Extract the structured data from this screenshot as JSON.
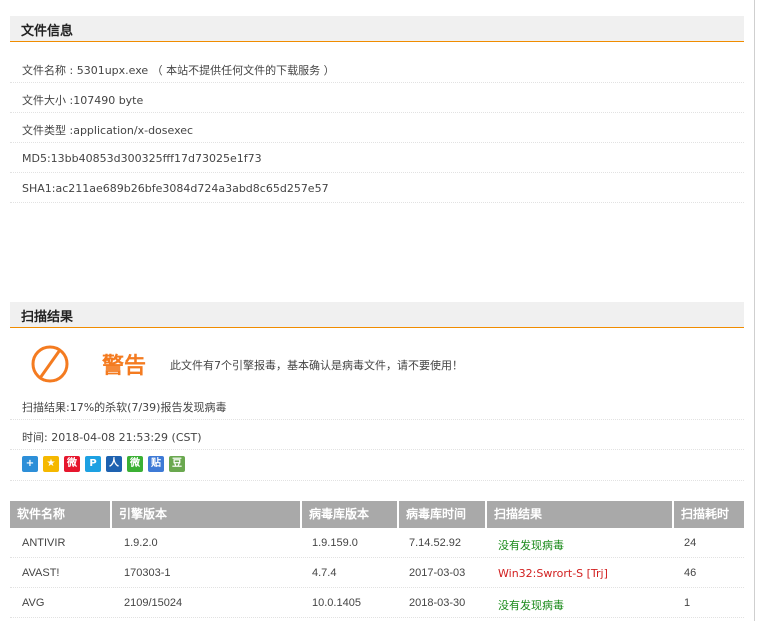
{
  "file_info": {
    "title": "文件信息",
    "rows": [
      "文件名称 : 5301upx.exe （ 本站不提供任何文件的下载服务 ）",
      "文件大小 :107490 byte",
      "文件类型 :application/x-dosexec",
      "MD5:13bb40853d300325fff17d73025e1f73",
      "SHA1:ac211ae689b26bfe3084d724a3abd8c65d257e57"
    ]
  },
  "scan": {
    "title": "扫描结果",
    "warning_title": "警告",
    "warning_text": "此文件有7个引擎报毒，基本确认是病毒文件，请不要使用！",
    "summary": "扫描结果:17%的杀软(7/39)报告发现病毒",
    "time": "时间: 2018-04-08 21:53:29 (CST)",
    "warning_color": "#f47b20",
    "share_icons": [
      {
        "name": "qzone-plus-icon",
        "glyph": "+",
        "color": "#2d8fd8"
      },
      {
        "name": "qzone-star-icon",
        "glyph": "★",
        "color": "#f5b800"
      },
      {
        "name": "weibo-icon",
        "glyph": "微",
        "color": "#e6162d"
      },
      {
        "name": "tencent-weibo-icon",
        "glyph": "P",
        "color": "#1da1e2"
      },
      {
        "name": "renren-icon",
        "glyph": "人",
        "color": "#1e62b0"
      },
      {
        "name": "wechat-icon",
        "glyph": "微",
        "color": "#3bb034"
      },
      {
        "name": "tieba-icon",
        "glyph": "贴",
        "color": "#3e7ad6"
      },
      {
        "name": "douban-icon",
        "glyph": "豆",
        "color": "#6aa84f"
      }
    ]
  },
  "table": {
    "headers": [
      "软件名称",
      "引擎版本",
      "病毒库版本",
      "病毒库时间",
      "扫描结果",
      "扫描耗时"
    ],
    "rows": [
      {
        "name": "ANTIVIR",
        "engine": "1.9.2.0",
        "db": "1.9.159.0",
        "db_time": "7.14.52.92",
        "result": "没有发现病毒",
        "result_status": "clean",
        "duration": "24"
      },
      {
        "name": "AVAST!",
        "engine": "170303-1",
        "db": "4.7.4",
        "db_time": "2017-03-03",
        "result": "Win32:Swrort-S [Trj]",
        "result_status": "infected",
        "duration": "46"
      },
      {
        "name": "AVG",
        "engine": "2109/15024",
        "db": "10.0.1405",
        "db_time": "2018-03-30",
        "result": "没有发现病毒",
        "result_status": "clean",
        "duration": "1"
      }
    ],
    "clean_color": "#1a8a1a",
    "infected_color": "#d22020"
  }
}
